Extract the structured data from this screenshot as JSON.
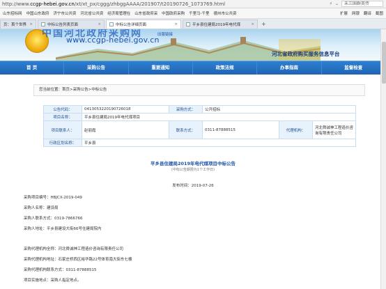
{
  "browser": {
    "url_prefix": "http://www.",
    "url_host": "ccgp-hebei.gov.cn",
    "url_path": "/xt/xt_px/cggg/zhbggAAAA/201907/t20190726_1073769.html",
    "search_placeholder": "未三国群英传",
    "bookmarks": [
      "山东招标网",
      "中国山东政府",
      "济宁市公共资",
      "河北省公共资",
      "经济局管理在",
      "山东省政府采",
      "中国政府采购",
      "千里马-千里",
      "德州市公共资"
    ],
    "tools": [
      "扩展",
      "网银",
      "翻译",
      "截图"
    ],
    "tabs": [
      {
        "label": "页：首个世界",
        "active": false
      },
      {
        "label": "中标公告列表页面",
        "active": false
      },
      {
        "label": "中标公告详细页面",
        "active": true
      },
      {
        "label": "平乡县住建局2019年电代煤",
        "active": false
      }
    ],
    "new_tab": "+"
  },
  "header": {
    "site_cn": "中国河北政府采购网",
    "site_url": "www.ccgp-hebei.gov.cn",
    "version_link": "旧版链接",
    "right_title": "河北省政府购买服务信息平台"
  },
  "nav": [
    "首 页",
    "采购公告",
    "重要通知",
    "政策法规",
    "办事指南",
    "监督检查"
  ],
  "breadcrumb": "您当前位置：首页>采购公告>中标公告",
  "info": {
    "rows": [
      {
        "l1": "公告代码：",
        "v1": "0413053220190726018",
        "l2": "采购方式：",
        "v2": "公开招标"
      },
      {
        "l1": "项目名称：",
        "v1": "平乡县住建局2019年电代煤项目"
      },
      {
        "l1": "项目联系人：",
        "v1": "赵丽霞",
        "l2": "联系方式：",
        "v2": "0311-87888515",
        "l3": "代理机构：",
        "v3": "河北舜诚神工程造价咨询有限责任公司"
      },
      {
        "l1": "行政区划名称：",
        "v1": "平乡县"
      }
    ]
  },
  "announcement": {
    "title": "平乡县住建局2019年电代煤项目中标公告",
    "subtitle": "(中标公告期限为1个工作日)",
    "date_label": "发布时间：",
    "date": "2019-07-26",
    "lines": [
      "采购项目编号：HBJCX-2019-049",
      "采购人名称：建设局",
      "采购人联系方式：0319-7866766",
      "采购人地址：平乡县建设大街66号住建局院内",
      "采购代理机构全称：河北舜诚神工程造价咨询有限责任公司",
      "采购代理机构地址：石家庄桥西区裕华路22号体育南大街东七楼",
      "采购代理机构联系方式：0311-87888515",
      "项目实施地点：采购人指定地点。"
    ]
  }
}
